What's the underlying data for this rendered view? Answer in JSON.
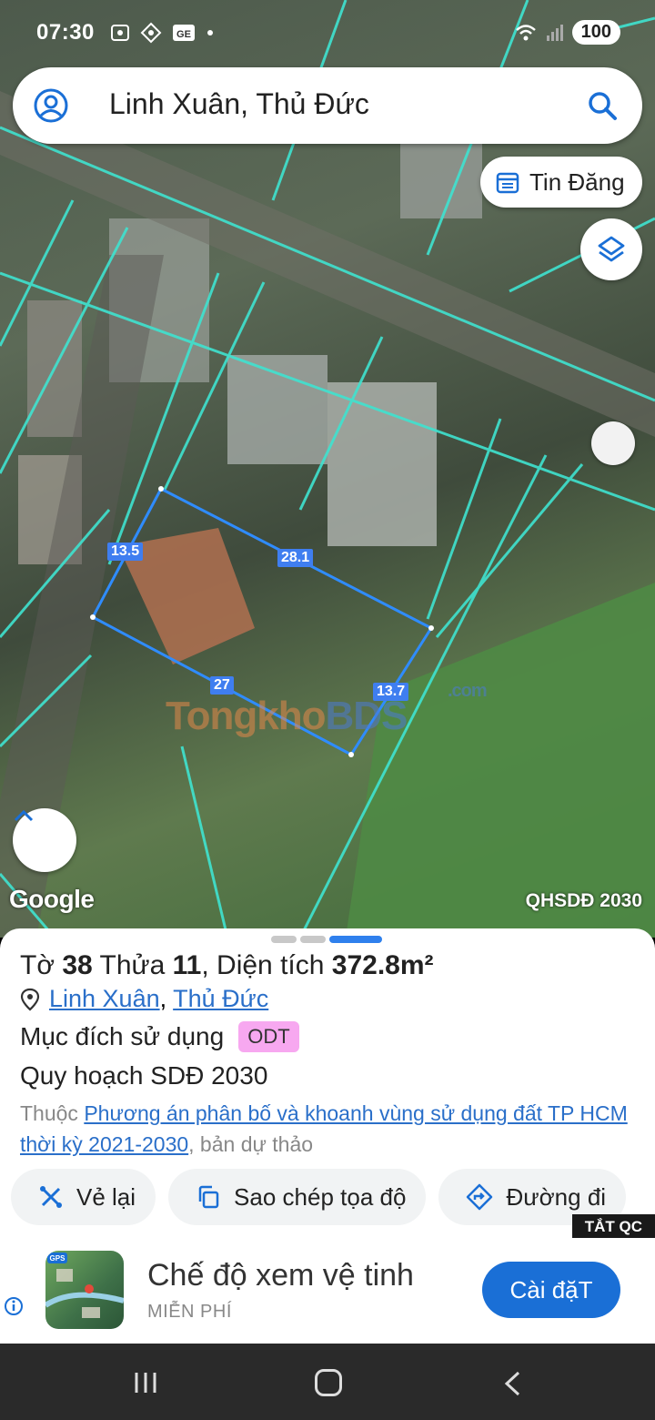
{
  "status": {
    "time": "07:30",
    "battery": "100",
    "ge_icon_label": "GE"
  },
  "search": {
    "text": "Linh Xuân, Thủ Đức"
  },
  "map": {
    "tin_dang_label": "Tin Đăng",
    "dimensions": [
      "13.5",
      "28.1",
      "27",
      "13.7"
    ],
    "google_logo": "Google",
    "layer_label": "QHSDĐ 2030",
    "watermark_left": "Tongkho",
    "watermark_right": "BDS",
    "watermark_com": ".com"
  },
  "sheet": {
    "to_label": "Tờ",
    "to_value": "38",
    "thua_label": "Thửa",
    "thua_value": "11",
    "dien_tich_label": ", Diện tích",
    "dien_tich_value": "372.8m²",
    "location_ward": "Linh Xuân",
    "location_sep": ",",
    "location_district": "Thủ Đức",
    "muc_dich_label": "Mục đích sử dụng",
    "muc_dich_badge": "ODT",
    "quy_hoach": "Quy hoạch SDĐ 2030",
    "thuoc_prefix": "Thuộc ",
    "thuoc_link": "Phương án phân bố và khoanh vùng sử dụng đất TP HCM thời kỳ 2021-2030",
    "thuoc_suffix": ", bản dự thảo",
    "actions": [
      "Vẻ lại",
      "Sao chép tọa độ",
      "Đường đi"
    ]
  },
  "ad": {
    "tag": "TẮT QC",
    "title": "Chế độ xem vệ tinh",
    "subtitle": "MIỄN PHÍ",
    "button": "Cài đặT",
    "icon_badge": "GPS"
  },
  "colors": {
    "accent": "#1a6fd6",
    "parcel_line": "#3fe3d0",
    "badge": "#f7a8f0"
  }
}
